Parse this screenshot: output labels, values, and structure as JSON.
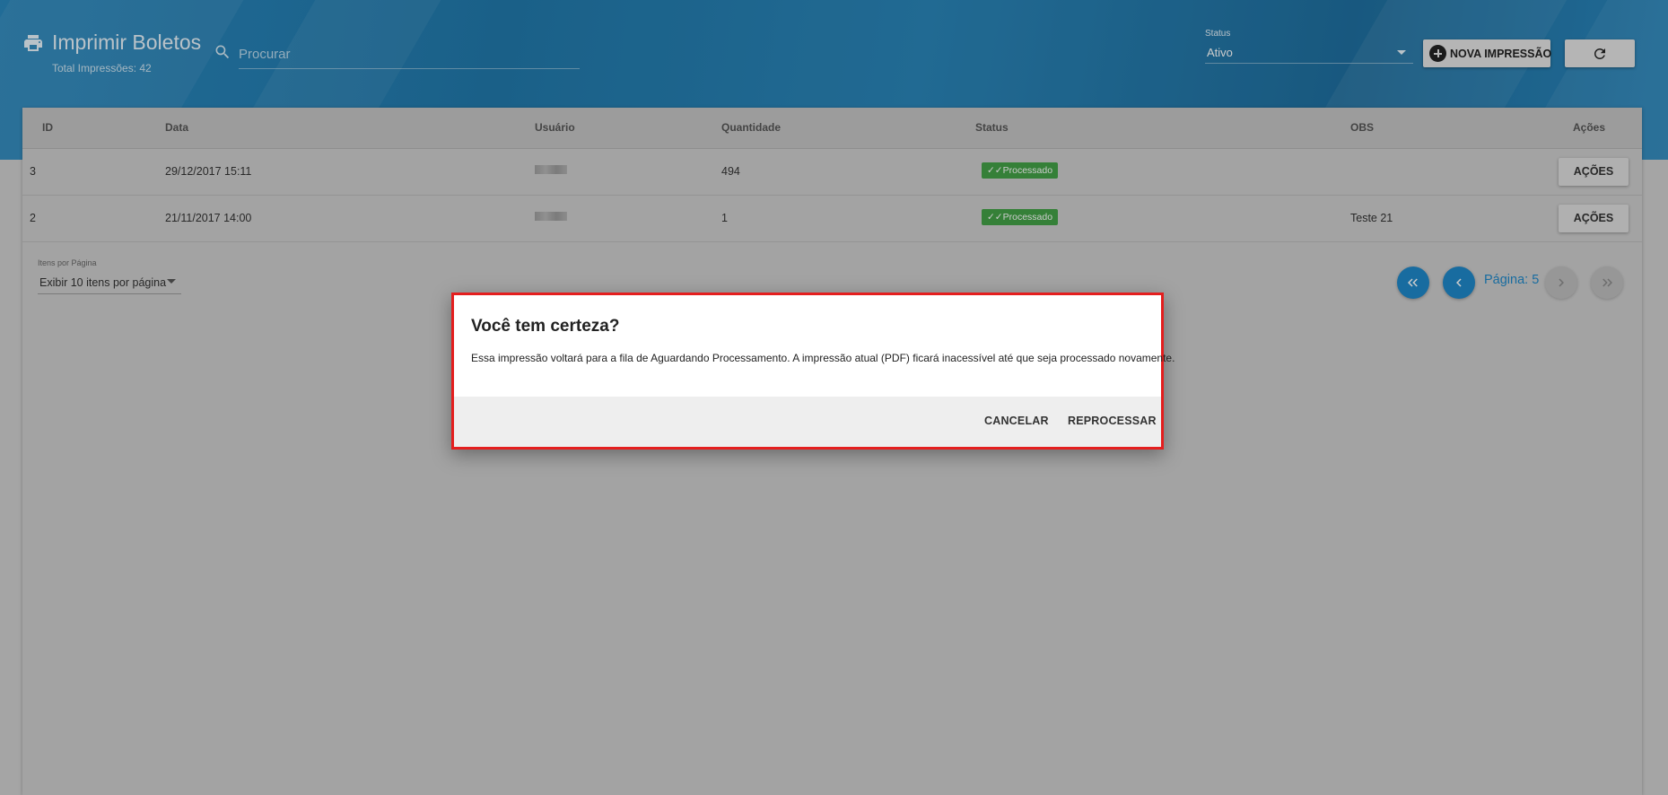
{
  "header": {
    "title": "Imprimir Boletos",
    "subtitle": "Total Impressões: 42",
    "search_placeholder": "Procurar",
    "status_label": "Status",
    "status_value": "Ativo",
    "new_button_label": "NOVA IMPRESSÃO"
  },
  "table": {
    "columns": [
      "ID",
      "Data",
      "Usuário",
      "Quantidade",
      "Status",
      "OBS",
      "Ações"
    ],
    "rows": [
      {
        "id": "3",
        "data": "29/12/2017 15:11",
        "usuario": "",
        "quantidade": "494",
        "status": "Processado",
        "obs": "",
        "acoes": "AÇÕES"
      },
      {
        "id": "2",
        "data": "21/11/2017 14:00",
        "usuario": "",
        "quantidade": "1",
        "status": "Processado",
        "obs": "Teste 21",
        "acoes": "AÇÕES"
      }
    ]
  },
  "pagination": {
    "items_label": "Itens por Página",
    "items_value": "Exibir 10 itens por página",
    "page_label": "Página: 5"
  },
  "dialog": {
    "title": "Você tem certeza?",
    "message": "Essa impressão voltará para a fila de Aguardando Processamento. A impressão atual (PDF) ficará inacessível até que seja processado novamente.",
    "cancel_label": "CANCELAR",
    "confirm_label": "REPROCESSAR"
  },
  "colors": {
    "header": "#2a87bd",
    "accent": "#1f87c9",
    "status_success": "#43a047",
    "dialog_highlight": "#e41e1e"
  },
  "icons": [
    "printer-icon",
    "search-icon",
    "plus-circle-icon",
    "refresh-icon",
    "check-icon",
    "first-page-icon",
    "prev-page-icon",
    "next-page-icon",
    "last-page-icon"
  ]
}
